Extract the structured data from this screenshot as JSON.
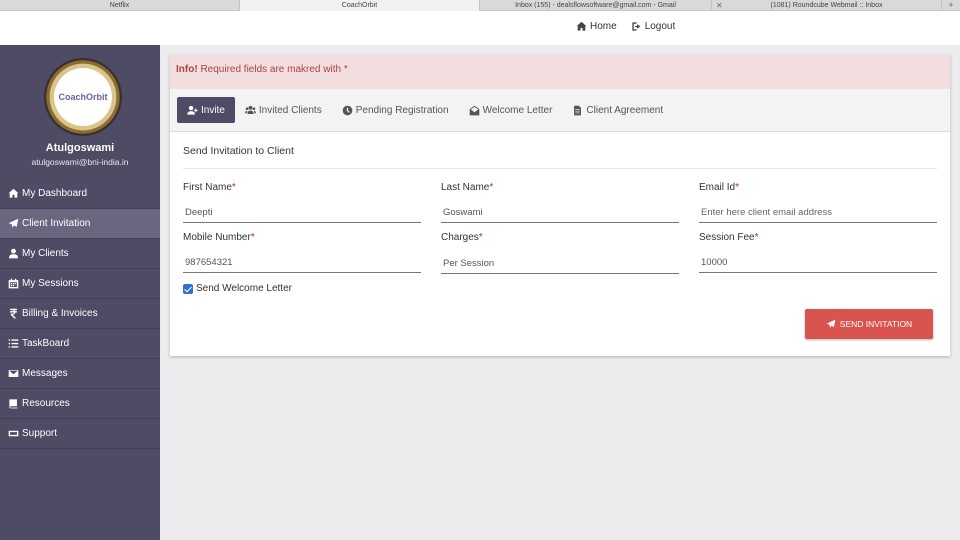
{
  "browser_tabs": [
    {
      "label": "Netflix",
      "active": false
    },
    {
      "label": "CoachOrbit",
      "active": true
    },
    {
      "label": "Inbox (155) - dealsflowsoftware@gmail.com - Gmail",
      "active": false
    },
    {
      "label": "(1081) Roundcube Webmail :: Inbox",
      "active": false
    }
  ],
  "topnav": {
    "home_label": "Home",
    "logout_label": "Logout"
  },
  "sidebar": {
    "logo_text": "CoachOrbit",
    "user_name": "Atulgoswami",
    "user_email": "atulgoswami@bni-india.in",
    "items": [
      {
        "label": "My Dashboard",
        "icon": "home-icon"
      },
      {
        "label": "Client Invitation",
        "icon": "paper-plane-icon",
        "active": true
      },
      {
        "label": "My Clients",
        "icon": "user-icon"
      },
      {
        "label": "My Sessions",
        "icon": "calendar-icon"
      },
      {
        "label": "Billing & Invoices",
        "icon": "rupee-icon"
      },
      {
        "label": "TaskBoard",
        "icon": "list-icon"
      },
      {
        "label": "Messages",
        "icon": "envelope-icon"
      },
      {
        "label": "Resources",
        "icon": "book-icon"
      },
      {
        "label": "Support",
        "icon": "ticket-icon"
      }
    ]
  },
  "alert": {
    "strong": "Info!",
    "text": "Required fields are makred with *"
  },
  "tabs": [
    {
      "label": "Invite",
      "icon": "user-plus-icon",
      "active": true
    },
    {
      "label": "Invited Clients",
      "icon": "users-icon"
    },
    {
      "label": "Pending Registration",
      "icon": "clock-icon"
    },
    {
      "label": "Welcome Letter",
      "icon": "envelope-open-icon"
    },
    {
      "label": "Client Agreement",
      "icon": "file-icon"
    }
  ],
  "form": {
    "section_title": "Send Invitation to Client",
    "first_name": {
      "label": "First Name",
      "value": "Deepti",
      "placeholder": ""
    },
    "last_name": {
      "label": "Last Name",
      "value": "Goswami",
      "placeholder": ""
    },
    "email": {
      "label": "Email Id",
      "value": "",
      "placeholder": "Enter here client email address"
    },
    "mobile": {
      "label": "Mobile Number",
      "value": "987654321",
      "placeholder": ""
    },
    "charges": {
      "label": "Charges",
      "value": "Per Session",
      "placeholder": ""
    },
    "session_fee": {
      "label": "Session Fee",
      "value": "10000",
      "placeholder": ""
    },
    "required_mark": "*",
    "welcome_checkbox": {
      "label": "Send Welcome Letter",
      "checked": true
    },
    "send_button": "SEND INVITATION"
  },
  "colors": {
    "sidebar_bg": "#4e4b65",
    "alert_bg": "#f2dede",
    "alert_text": "#a94442",
    "send_button_bg": "#d9534f"
  }
}
